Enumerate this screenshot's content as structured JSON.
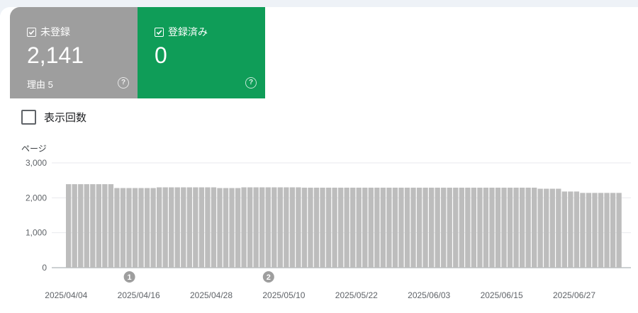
{
  "cards": {
    "unregistered": {
      "label": "未登録",
      "value": "2,141",
      "sub": "理由 5",
      "help": "?"
    },
    "registered": {
      "label": "登録済み",
      "value": "0",
      "help": "?"
    }
  },
  "impressions_toggle": {
    "label": "表示回数",
    "checked": false
  },
  "colors": {
    "unregistered": "#9e9e9e",
    "registered": "#0f9d58",
    "bar": "#bdbdbd"
  },
  "chart_data": {
    "type": "bar",
    "ylabel": "ページ",
    "ylim": [
      0,
      3000
    ],
    "yticks": [
      "3,000",
      "2,000",
      "1,000",
      "0"
    ],
    "yticks_values": [
      3000,
      2000,
      1000,
      0
    ],
    "xtick_labels": [
      "2025/04/04",
      "2025/04/16",
      "2025/04/28",
      "2025/05/10",
      "2025/05/22",
      "2025/06/03",
      "2025/06/15",
      "2025/06/27"
    ],
    "annotations": [
      {
        "label": "1",
        "date": "2025/04/14"
      },
      {
        "label": "2",
        "date": "2025/05/07"
      }
    ],
    "series": [
      {
        "color": "#bdbdbd",
        "values": [
          2390,
          2390,
          2390,
          2390,
          2390,
          2390,
          2390,
          2390,
          2280,
          2280,
          2280,
          2280,
          2280,
          2280,
          2280,
          2300,
          2300,
          2300,
          2300,
          2300,
          2300,
          2300,
          2300,
          2300,
          2300,
          2280,
          2280,
          2280,
          2280,
          2300,
          2300,
          2300,
          2300,
          2300,
          2300,
          2300,
          2300,
          2300,
          2300,
          2290,
          2290,
          2290,
          2290,
          2290,
          2290,
          2290,
          2290,
          2290,
          2290,
          2290,
          2290,
          2290,
          2290,
          2290,
          2290,
          2290,
          2290,
          2290,
          2290,
          2290,
          2290,
          2290,
          2290,
          2290,
          2290,
          2290,
          2290,
          2290,
          2290,
          2290,
          2290,
          2290,
          2290,
          2290,
          2290,
          2290,
          2290,
          2290,
          2260,
          2260,
          2260,
          2260,
          2180,
          2180,
          2180,
          2141,
          2141,
          2141,
          2141,
          2141,
          2141,
          2141
        ]
      }
    ]
  }
}
